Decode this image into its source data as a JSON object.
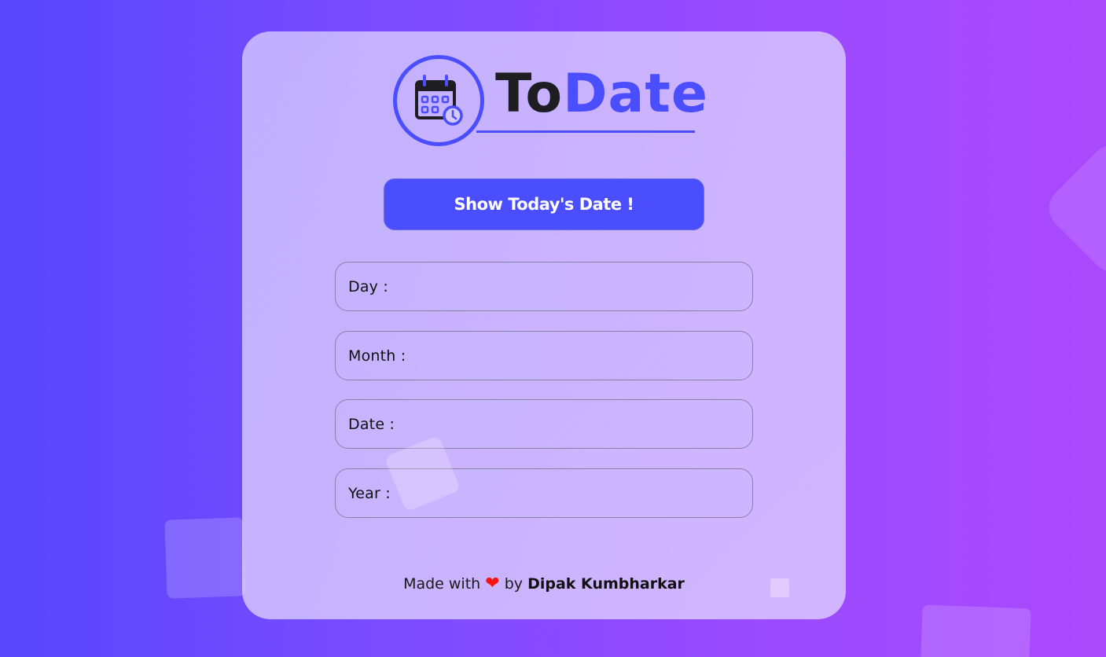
{
  "app": {
    "title_part1": "To",
    "title_part2": "Date",
    "brand_color": "#4a4eff"
  },
  "icons": {
    "logo": "calendar-clock-icon",
    "heart": "heart-icon"
  },
  "button": {
    "label": "Show Today's Date !"
  },
  "fields": {
    "day_label": "Day :",
    "day_value": "",
    "month_label": "Month :",
    "month_value": "",
    "date_label": "Date :",
    "date_value": "",
    "year_label": "Year :",
    "year_value": ""
  },
  "footer": {
    "prefix": "Made with",
    "heart": "❤",
    "middle": "by",
    "author": "Dipak Kumbharkar"
  }
}
